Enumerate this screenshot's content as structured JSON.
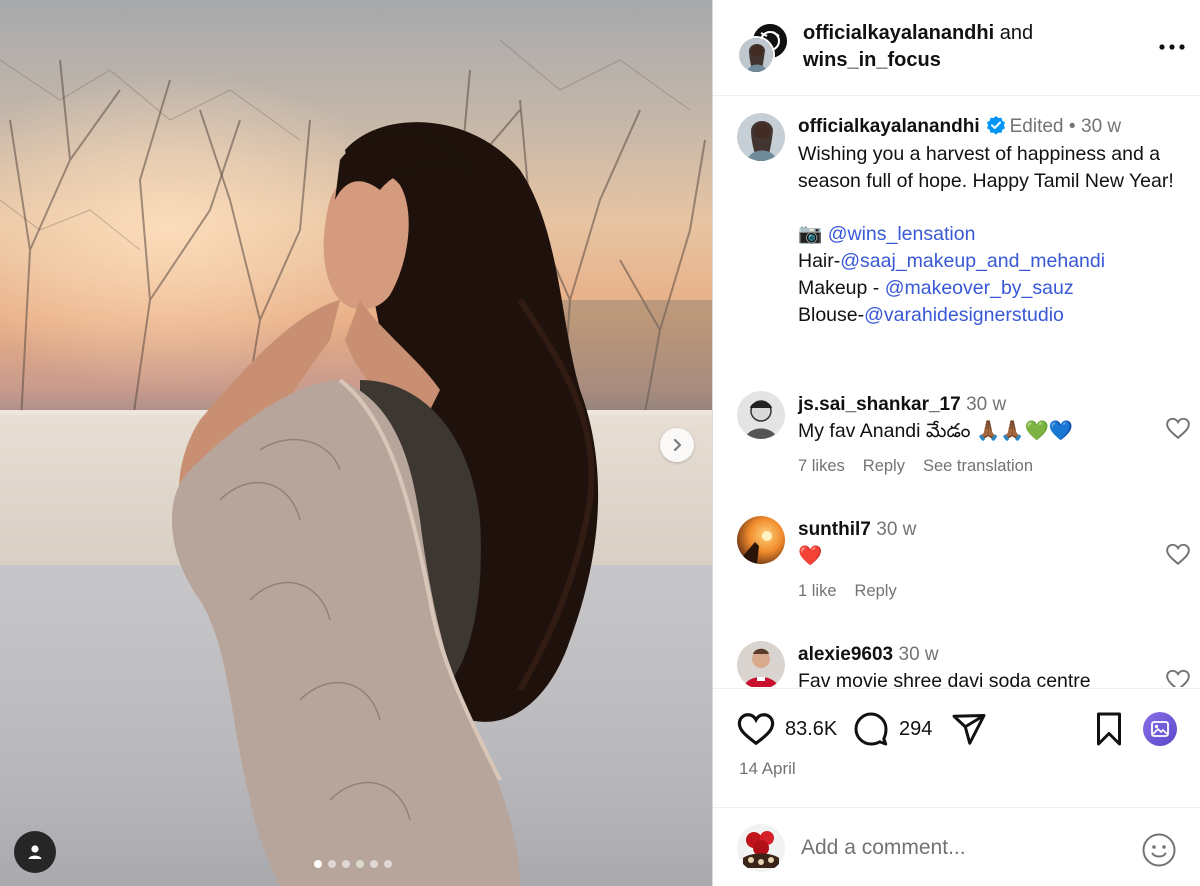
{
  "media": {
    "carousel_total": 6,
    "carousel_active_index": 0
  },
  "header": {
    "user1": "officialkayalanandhi",
    "and_text": "and",
    "user2": "wins_in_focus"
  },
  "caption": {
    "username": "officialkayalanandhi",
    "edited_label": "Edited",
    "separator": "•",
    "time": "30 w",
    "text": "Wishing you a harvest of happiness and a season full of hope. Happy Tamil New Year!",
    "camera_emoji": "📷",
    "credit_photo": "@wins_lensation",
    "credit_hair_label": "Hair-",
    "credit_hair": "@saaj_makeup_and_mehandi",
    "credit_makeup_label": "Makeup - ",
    "credit_makeup": "@makeover_by_sauz",
    "credit_blouse_label": "Blouse-",
    "credit_blouse": "@varahidesignerstudio"
  },
  "comments": [
    {
      "username": "js.sai_shankar_17",
      "time": "30 w",
      "text": "My fav Anandi మేడం 🙏🏾🙏🏾💚💙",
      "likes": "7 likes",
      "reply": "Reply",
      "translate": "See translation"
    },
    {
      "username": "sunthil7",
      "time": "30 w",
      "text": "❤️",
      "likes": "1 like",
      "reply": "Reply"
    },
    {
      "username": "alexie9603",
      "time": "30 w",
      "text": "Fav movie shree davi soda centre"
    }
  ],
  "footer": {
    "like_count": "83.6K",
    "comment_count": "294",
    "date": "14 April",
    "comment_placeholder": "Add a comment..."
  },
  "colors": {
    "link": "#3858d6",
    "verified": "#0095f6",
    "muted": "#737373",
    "accent_icon": "#6f5bd6"
  },
  "icons": {
    "like": "heart-icon",
    "comment": "comment-bubble-icon",
    "share": "paper-plane-icon",
    "save": "bookmark-icon",
    "media": "image-icon",
    "more": "more-horizontal-icon",
    "next": "chevron-right-icon",
    "tags": "user-icon",
    "emoji": "smiley-icon",
    "verified": "verified-badge-icon"
  }
}
